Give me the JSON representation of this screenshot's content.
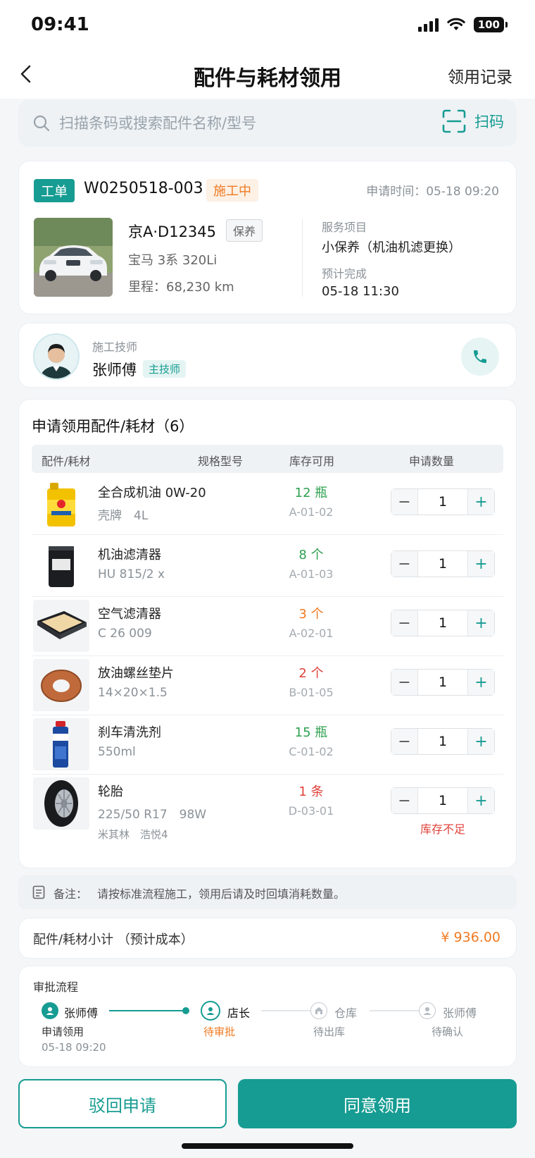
{
  "status_bar": {
    "time": "09:41",
    "battery": "100"
  },
  "nav": {
    "title": "配件与耗材领用",
    "right_link": "领用记录"
  },
  "search": {
    "placeholder": "扫描条码或搜索配件名称/型号",
    "scan_label": "扫码"
  },
  "work_order": {
    "tag": "工单",
    "number": "W0250518-003",
    "status": "施工中",
    "apply_time": "申请时间：05-18 09:20",
    "vehicle": {
      "plate": "京A·D12345",
      "tag": "保养",
      "model": "宝马 3系 320Li",
      "mileage": "里程：68,230 km"
    },
    "service_label": "服务项目",
    "service_value": "小保养（机油机滤更换）",
    "eta_label": "预计完成",
    "eta_value": "05-18 11:30"
  },
  "technician": {
    "role": "施工技师",
    "name": "张师傅",
    "badge": "主技师"
  },
  "parts": {
    "title": "申请领用配件/耗材（6）",
    "columns": [
      "配件/耗材",
      "规格型号",
      "库存可用",
      "申请数量"
    ],
    "items": [
      {
        "name": "全合成机油 0W-20",
        "spec": "壳牌　4L",
        "stock": "12 瓶",
        "location": "A-01-02",
        "qty": "1",
        "stock_color": "#2ea04f"
      },
      {
        "name": "机油滤清器",
        "spec": "HU 815/2 x",
        "stock": "8 个",
        "location": "A-01-03",
        "qty": "1",
        "stock_color": "#2ea04f"
      },
      {
        "name": "空气滤清器",
        "spec": "C 26 009",
        "stock": "3 个",
        "location": "A-02-01",
        "qty": "1",
        "stock_color": "#f07a23"
      },
      {
        "name": "放油螺丝垫片",
        "spec": "14×20×1.5",
        "stock": "2 个",
        "location": "B-01-05",
        "qty": "1",
        "stock_color": "#e0413a"
      },
      {
        "name": "刹车清洗剂",
        "spec": "550ml",
        "stock": "15 瓶",
        "location": "C-01-02",
        "qty": "1",
        "stock_color": "#2ea04f"
      },
      {
        "name": "轮胎",
        "spec": "225/50 R17　98W",
        "brand": "米其林　浩悦4",
        "stock": "1 条",
        "location": "D-03-01",
        "qty": "1",
        "stock_color": "#e0413a",
        "warning": "库存不足"
      }
    ]
  },
  "note": {
    "label": "备注：",
    "text": "请按标准流程施工，领用后请及时回填消耗数量。"
  },
  "subtotal": {
    "label": "配件/耗材小计 （预计成本）",
    "value": "¥ 936.00"
  },
  "approval": {
    "title": "审批流程",
    "steps": [
      {
        "name": "张师傅",
        "status": "申请领用",
        "time": "05-18 09:20"
      },
      {
        "name": "店长",
        "status": "待审批"
      },
      {
        "name": "仓库",
        "status": "待出库"
      },
      {
        "name": "张师傅",
        "status": "待确认"
      }
    ]
  },
  "actions": {
    "reject": "驳回申请",
    "approve": "同意领用"
  },
  "colors": {
    "accent": "#169c92",
    "warning": "#f07a23",
    "danger": "#e0413a",
    "ok": "#2ea04f"
  }
}
